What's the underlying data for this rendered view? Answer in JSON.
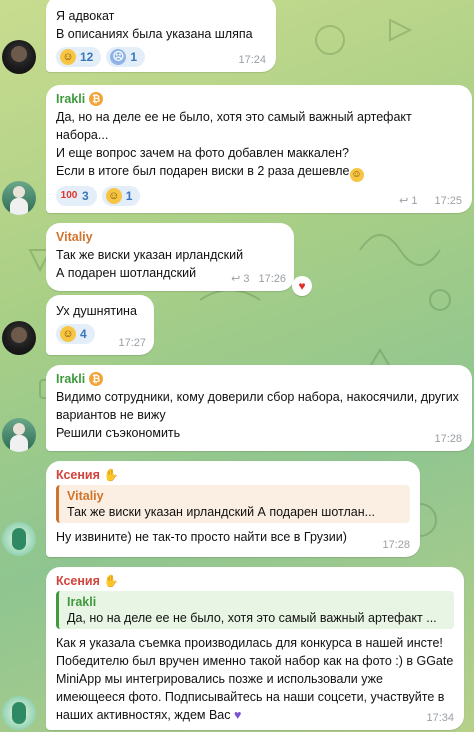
{
  "theme": {
    "accent_reaction_bg": "#e3eef9",
    "reaction_text": "#3a76b8",
    "bubble_bg": "#ffffff"
  },
  "messages": [
    {
      "text": "Я адвокат\nВ описаниях была указана шляпа",
      "reactions": [
        {
          "icon": "grin-emoji",
          "count": "12"
        },
        {
          "icon": "scream-emoji",
          "count": "1"
        }
      ],
      "time": "17:24"
    },
    {
      "sender": "Irakli",
      "text": "Да, но на деле ее не было, хотя это самый важный артефакт набора...\nИ еще вопрос зачем на фото добавлен маккален?\nЕсли в итоге был подарен виски в 2 раза дешевле",
      "reactions": [
        {
          "icon": "hundred-emoji",
          "count": "3"
        },
        {
          "icon": "grin-emoji",
          "count": "1"
        }
      ],
      "replies": "1",
      "time": "17:25"
    },
    {
      "sender": "Vitaliy",
      "text": "Так же виски указан ирландский\nА подарен шотландский",
      "replies": "3",
      "time": "17:26"
    },
    {
      "text": "Ух душнятина",
      "reactions": [
        {
          "icon": "grin-emoji",
          "count": "4"
        }
      ],
      "time": "17:27"
    },
    {
      "sender": "Irakli",
      "text": "Видимо сотрудники, кому доверили сбор набора, накосячили, других вариантов не вижу\nРешили съэкономить",
      "time": "17:28"
    },
    {
      "sender": "Ксения",
      "quote_name": "Vitaliy",
      "quote_text": "Так же виски указан ирландский  А подарен шотлан...",
      "text": "Ну извините) не так-то просто найти все в Грузии)",
      "time": "17:28"
    },
    {
      "sender": "Ксения",
      "quote_name": "Irakli",
      "quote_text": "Да, но на деле ее не было, хотя это самый важный артефакт ...",
      "text": "Как я указала съемка производилась для конкурса в нашей инсте! Победителю был вручен именно такой набор как на фото :) в GGate MiniApp мы интегрировались позже и использовали уже имеющееся фото. Подписывайтесь на наши соцсети, участвуйте в наших активностях, ждем Вас",
      "time": "17:34"
    }
  ]
}
